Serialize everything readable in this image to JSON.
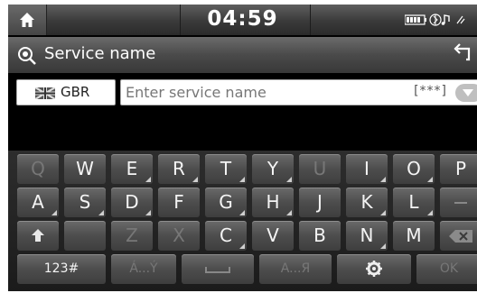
{
  "status": {
    "time": "04:59",
    "icons_text": "▥▥ ◉♪ ▾"
  },
  "header": {
    "title": "Service name"
  },
  "input": {
    "region": "GBR",
    "placeholder": "Enter service name",
    "wildcard": "[***]"
  },
  "keyboard": {
    "row1": [
      "Q",
      "W",
      "E",
      "R",
      "T",
      "Y",
      "U",
      "I",
      "O",
      "P"
    ],
    "row2": [
      "A",
      "S",
      "D",
      "F",
      "G",
      "H",
      "J",
      "K",
      "L"
    ],
    "row3": [
      "Z",
      "X",
      "C",
      "V",
      "B",
      "N",
      "M"
    ],
    "mode_label": "123#",
    "accent_label": "Á...Ý",
    "cyrillic_label": "A...Я",
    "ok_label": "OK"
  },
  "colors": {
    "key_text": "#f4f4f4",
    "key_disabled_text": "#777777",
    "background": "#000000"
  }
}
